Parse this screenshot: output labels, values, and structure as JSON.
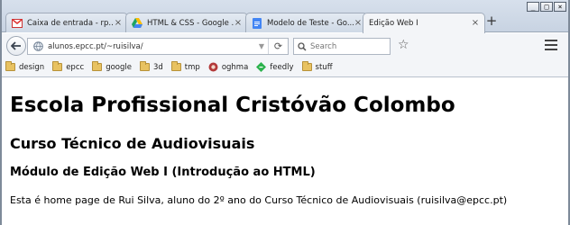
{
  "window": {
    "controls": [
      "_",
      "□",
      "×"
    ],
    "tabs": [
      {
        "title": "Caixa de entrada - rp...",
        "icon": "gmail-icon",
        "active": false
      },
      {
        "title": "HTML & CSS - Google ...",
        "icon": "google-drive-icon",
        "active": false
      },
      {
        "title": "Modelo de Teste - Go...",
        "icon": "google-docs-icon",
        "active": false
      },
      {
        "title": "Edição Web I",
        "icon": "",
        "active": true
      }
    ],
    "new_tab": "+",
    "close_glyph": "×"
  },
  "navbar": {
    "url": "alunos.epcc.pt/~ruisilva/",
    "search_placeholder": "Search"
  },
  "bookmarks": [
    {
      "label": "design",
      "type": "folder"
    },
    {
      "label": "epcc",
      "type": "folder"
    },
    {
      "label": "google",
      "type": "folder"
    },
    {
      "label": "3d",
      "type": "folder"
    },
    {
      "label": "tmp",
      "type": "folder"
    },
    {
      "label": "oghma",
      "type": "site"
    },
    {
      "label": "feedly",
      "type": "site"
    },
    {
      "label": "stuff",
      "type": "folder"
    }
  ],
  "page": {
    "h1": "Escola Profissional Cristóvão Colombo",
    "h2": "Curso Técnico de Audiovisuais",
    "h3": "Módulo de Edição Web I (Introdução ao HTML)",
    "paragraph": "Esta é home page de Rui Silva, aluno do 2º ano do Curso Técnico de Audiovisuais (ruisilva@epcc.pt)"
  }
}
